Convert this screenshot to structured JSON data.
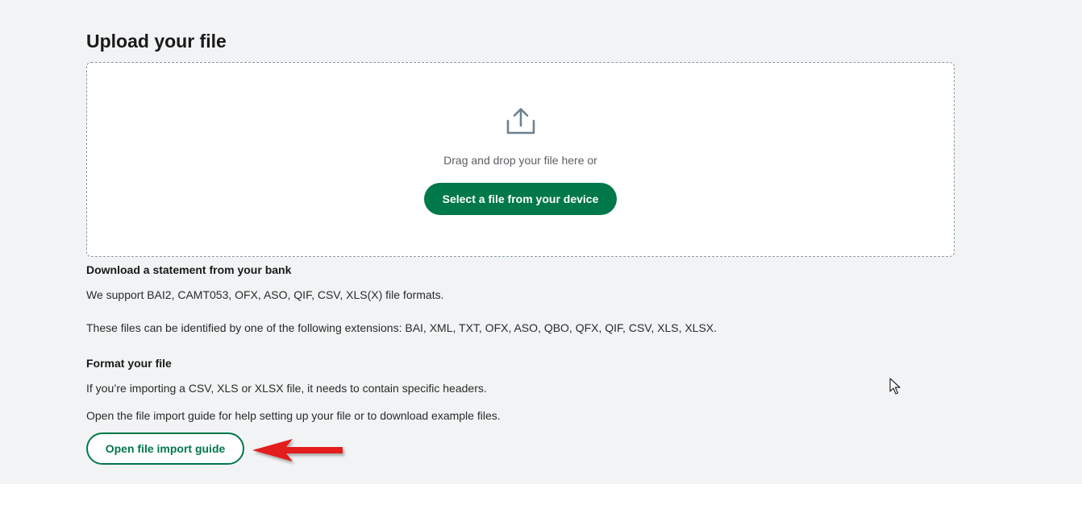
{
  "upload": {
    "title": "Upload your file",
    "dropzone_text": "Drag and drop your file here or",
    "select_button": "Select a file from your device",
    "icon": "upload-icon"
  },
  "bank_section": {
    "heading": "Download a statement from your bank",
    "formats_text": "We support BAI2, CAMT053, OFX, ASO, QIF, CSV, XLS(X) file formats.",
    "extensions_text": "These files can be identified by one of the following extensions: BAI, XML, TXT, OFX, ASO, QBO, QFX, QIF, CSV, XLS, XLSX."
  },
  "format_section": {
    "heading": "Format your file",
    "headers_text": "If you’re importing a CSV, XLS or XLSX file, it needs to contain specific headers.",
    "guide_text": "Open the file import guide for help setting up your file or to download example files.",
    "guide_button": "Open file import guide"
  },
  "colors": {
    "primary_green": "#00784a",
    "page_background": "#f1f3f4",
    "annotation_arrow": "#e31b1b"
  },
  "annotation": {
    "icon": "red-arrow-icon"
  }
}
